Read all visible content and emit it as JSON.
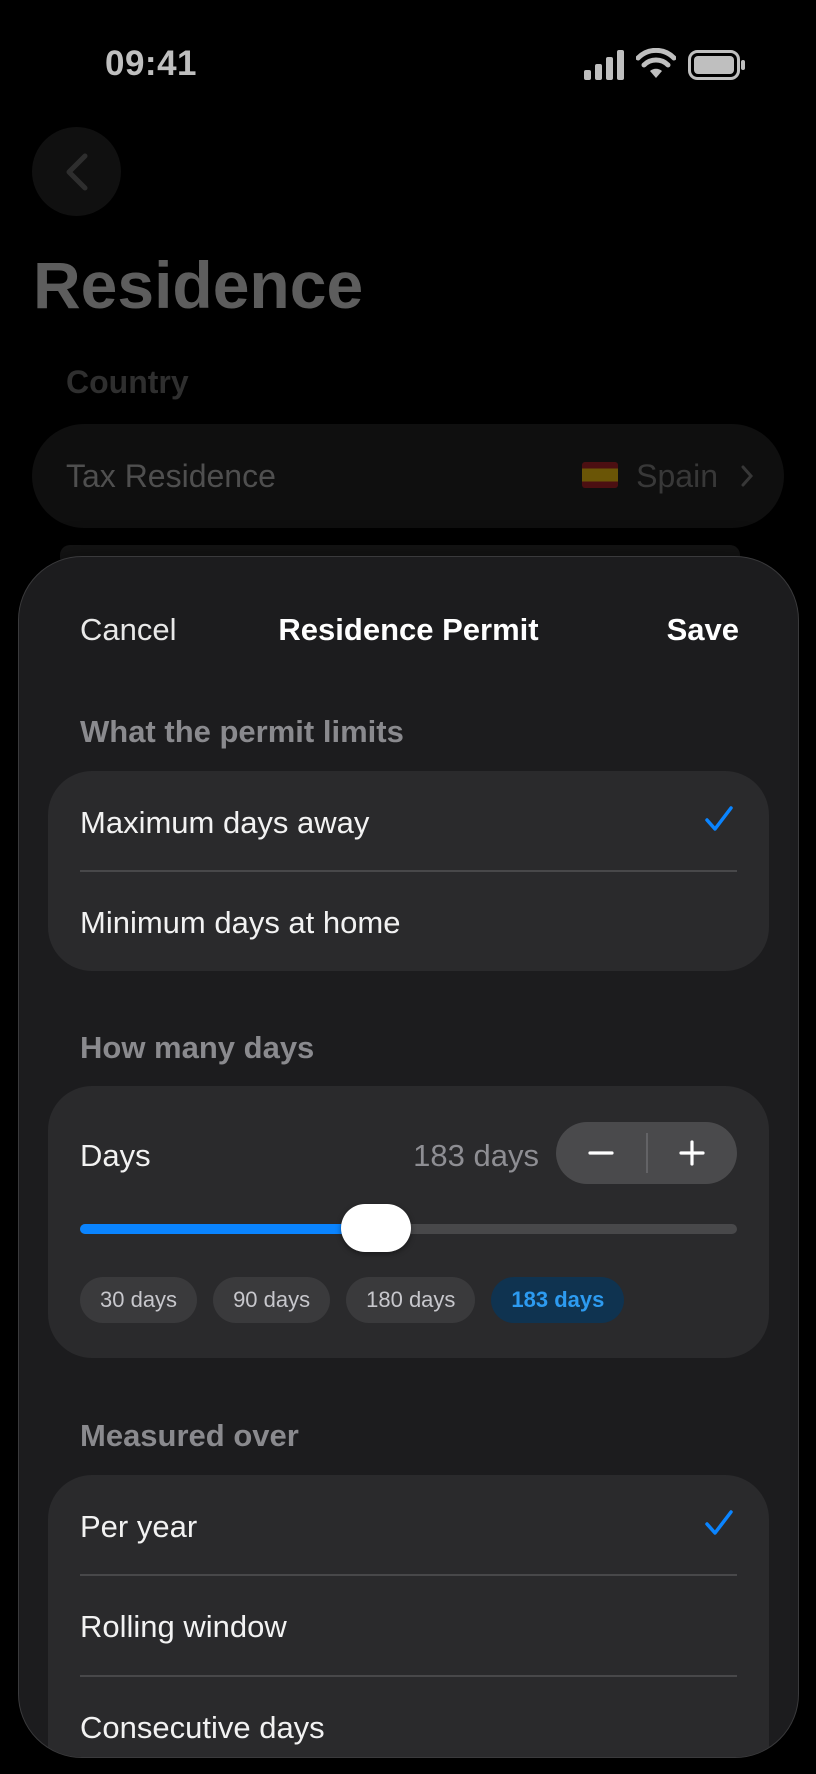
{
  "status": {
    "time": "09:41"
  },
  "background": {
    "title": "Residence",
    "section": "Country",
    "row": {
      "label": "Tax Residence",
      "value": "Spain"
    }
  },
  "sheet": {
    "cancel": "Cancel",
    "title": "Residence Permit",
    "save": "Save",
    "limits": {
      "label": "What the permit limits",
      "options": [
        {
          "label": "Maximum days away",
          "selected": true
        },
        {
          "label": "Minimum days at home",
          "selected": false
        }
      ]
    },
    "days": {
      "label": "How many days",
      "row_label": "Days",
      "value": "183 days",
      "slider_fraction": 0.45,
      "presets": [
        {
          "label": "30 days",
          "active": false
        },
        {
          "label": "90 days",
          "active": false
        },
        {
          "label": "180 days",
          "active": false
        },
        {
          "label": "183 days",
          "active": true
        }
      ]
    },
    "measured": {
      "label": "Measured over",
      "options": [
        {
          "label": "Per year",
          "selected": true
        },
        {
          "label": "Rolling window",
          "selected": false
        },
        {
          "label": "Consecutive days",
          "selected": false
        }
      ]
    }
  },
  "colors": {
    "accent": "#0a84ff",
    "sheet_bg": "#1c1c1e",
    "group_bg": "#2a2a2c"
  },
  "icons": {
    "back": "chevron-left-icon",
    "check": "checkmark-icon",
    "minus": "minus-icon",
    "plus": "plus-icon"
  }
}
